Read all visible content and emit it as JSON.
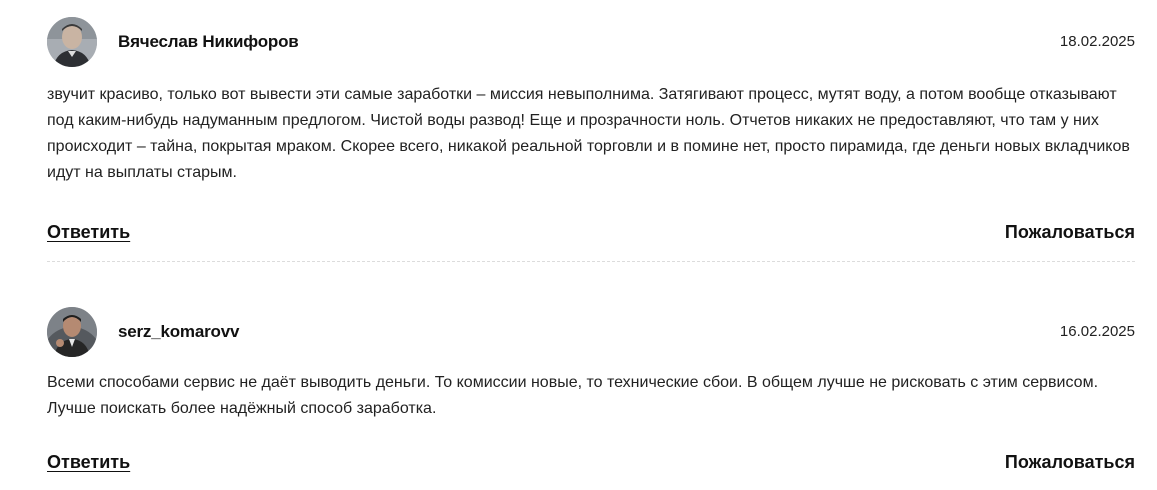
{
  "comments": [
    {
      "author": "Вячеслав Никифоров",
      "date": "18.02.2025",
      "text": "звучит красиво, только вот вывести эти самые заработки – миссия невыполнима. Затягивают процесс, мутят воду, а потом вообще отказывают под каким-нибудь надуманным предлогом. Чистой воды развод! Еще и прозрачности ноль. Отчетов никаких не предоставляют, что там у них происходит – тайна, покрытая мраком. Скорее всего, никакой реальной торговли и в помине нет, просто пирамида, где деньги новых вкладчиков идут на выплаты старым.",
      "reply_label": "Ответить",
      "report_label": "Пожаловаться"
    },
    {
      "author": "serz_komarovv",
      "date": "16.02.2025",
      "text": "Всеми способами сервис не даёт выводить деньги. То комиссии новые, то технические сбои. В общем лучше не рисковать с этим сервисом. Лучше поискать более надёжный способ заработка.",
      "reply_label": "Ответить",
      "report_label": "Пожаловаться"
    }
  ]
}
